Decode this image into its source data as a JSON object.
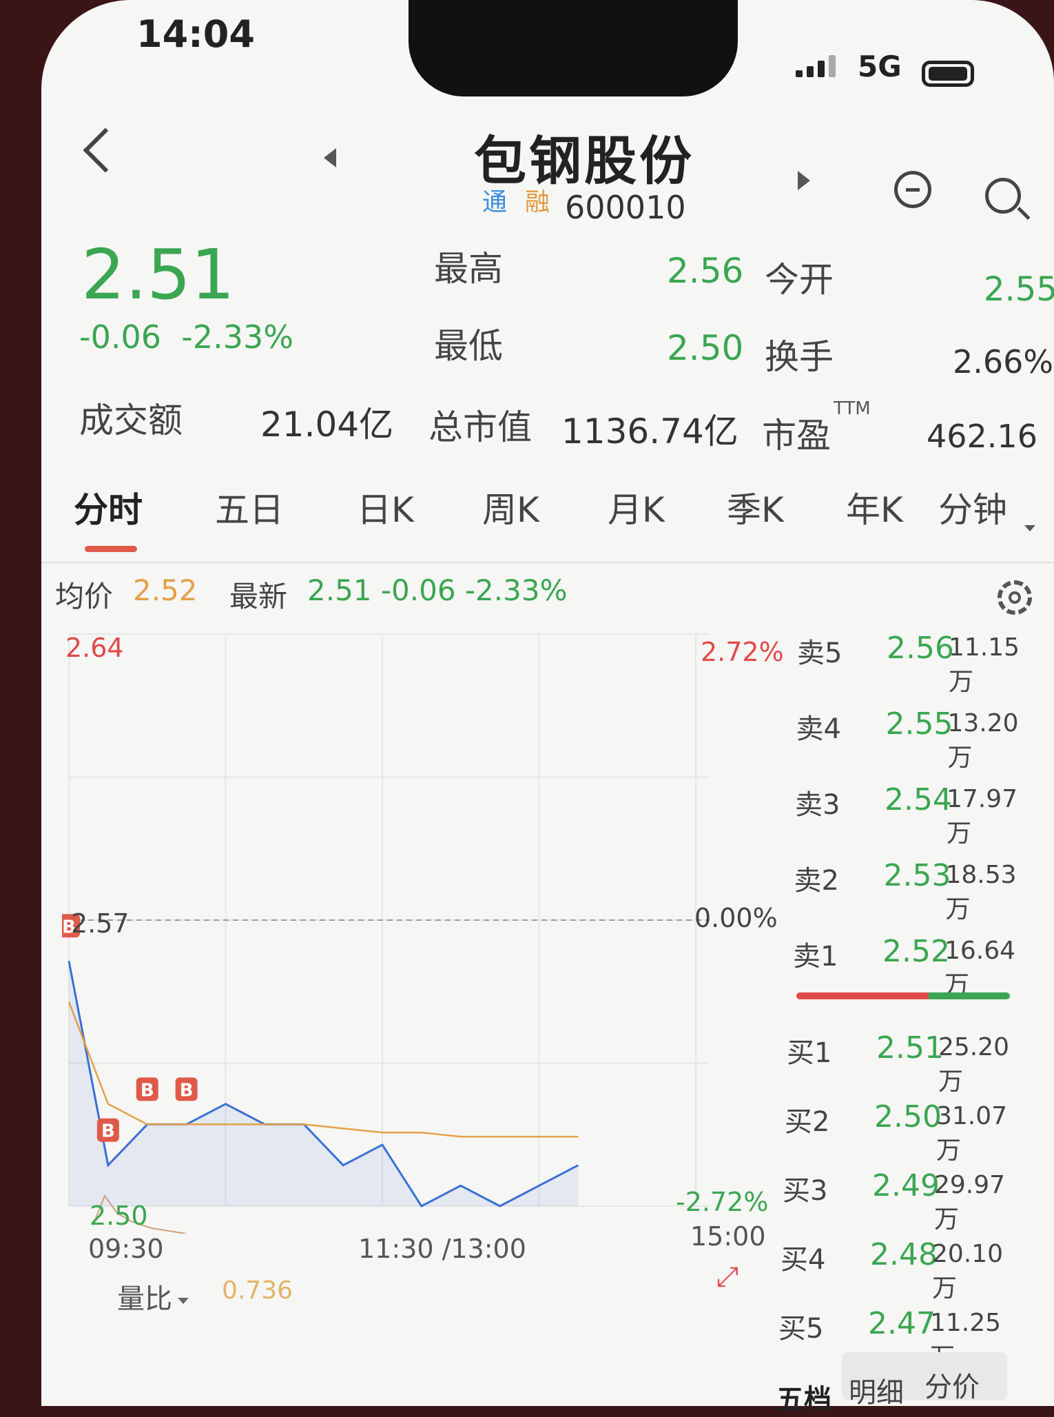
{
  "status": {
    "time": "14:04",
    "network": "5G"
  },
  "header": {
    "name": "包钢股份",
    "tag1": "通",
    "tag2": "融",
    "code": "600010"
  },
  "quote": {
    "price": "2.51",
    "change": "-0.06",
    "change_pct": "-2.33%",
    "high_label": "最高",
    "high": "2.56",
    "open_label": "今开",
    "open": "2.55",
    "low_label": "最低",
    "low": "2.50",
    "turnover_label": "换手",
    "turnover": "2.66%",
    "amount_label": "成交额",
    "amount": "21.04亿",
    "mktcap_label": "总市值",
    "mktcap": "1136.74亿",
    "pe_label": "市盈",
    "pe_sup": "TTM",
    "pe": "462.16"
  },
  "tabs": [
    "分时",
    "五日",
    "日K",
    "周K",
    "月K",
    "季K",
    "年K",
    "分钟"
  ],
  "info_bar": {
    "avg_label": "均价",
    "avg": "2.52",
    "latest_label": "最新",
    "latest": "2.51",
    "latest_change": "-0.06",
    "latest_pct": "-2.33%"
  },
  "chart": {
    "y_top": "2.64",
    "y_mid": "2.57",
    "y_bottom": "2.50",
    "pct_top": "2.72%",
    "pct_mid": "0.00%",
    "pct_bottom": "-2.72%",
    "x_start": "09:30",
    "x_mid": "11:30 /13:00",
    "x_end": "15:00",
    "marker": "B",
    "vol_ratio_label": "量比",
    "vol_ratio": "0.736"
  },
  "chart_data": {
    "type": "line",
    "xlabel": "",
    "ylabel": "",
    "ylim": [
      2.5,
      2.64
    ],
    "x": [
      "09:30",
      "09:45",
      "10:00",
      "10:15",
      "10:30",
      "10:45",
      "11:00",
      "11:15",
      "11:30",
      "13:15",
      "13:30",
      "13:45",
      "14:00",
      "14:15"
    ],
    "series": [
      {
        "values": [
          2.56,
          2.51,
          2.52,
          2.52,
          2.525,
          2.52,
          2.52,
          2.51,
          2.515,
          2.5,
          2.505,
          2.5,
          2.505,
          2.51
        ]
      },
      {
        "values": [
          2.55,
          2.525,
          2.52,
          2.52,
          2.52,
          2.52,
          2.52,
          2.519,
          2.518,
          2.518,
          2.517,
          2.517,
          2.517,
          2.517
        ]
      }
    ],
    "markers": [
      {
        "x": "09:30",
        "label": "B"
      },
      {
        "x": "09:45",
        "label": "B"
      },
      {
        "x": "10:00",
        "label": "B"
      },
      {
        "x": "10:15",
        "label": "B"
      }
    ]
  },
  "orderbook": {
    "asks": [
      {
        "label": "卖5",
        "price": "2.56",
        "vol": "11.15万"
      },
      {
        "label": "卖4",
        "price": "2.55",
        "vol": "13.20万"
      },
      {
        "label": "卖3",
        "price": "2.54",
        "vol": "17.97万"
      },
      {
        "label": "卖2",
        "price": "2.53",
        "vol": "18.53万"
      },
      {
        "label": "卖1",
        "price": "2.52",
        "vol": "16.64万"
      }
    ],
    "bids": [
      {
        "label": "买1",
        "price": "2.51",
        "vol": "25.20万"
      },
      {
        "label": "买2",
        "price": "2.50",
        "vol": "31.07万"
      },
      {
        "label": "买3",
        "price": "2.49",
        "vol": "29.97万"
      },
      {
        "label": "买4",
        "price": "2.48",
        "vol": "20.10万"
      },
      {
        "label": "买5",
        "price": "2.47",
        "vol": "11.25万"
      }
    ]
  },
  "bottom_tabs": [
    "五档",
    "明细",
    "分价"
  ],
  "colors": {
    "up": "#e04a4a",
    "down": "#3aa651",
    "avg": "#e3a049",
    "line": "#3b6fd6"
  }
}
